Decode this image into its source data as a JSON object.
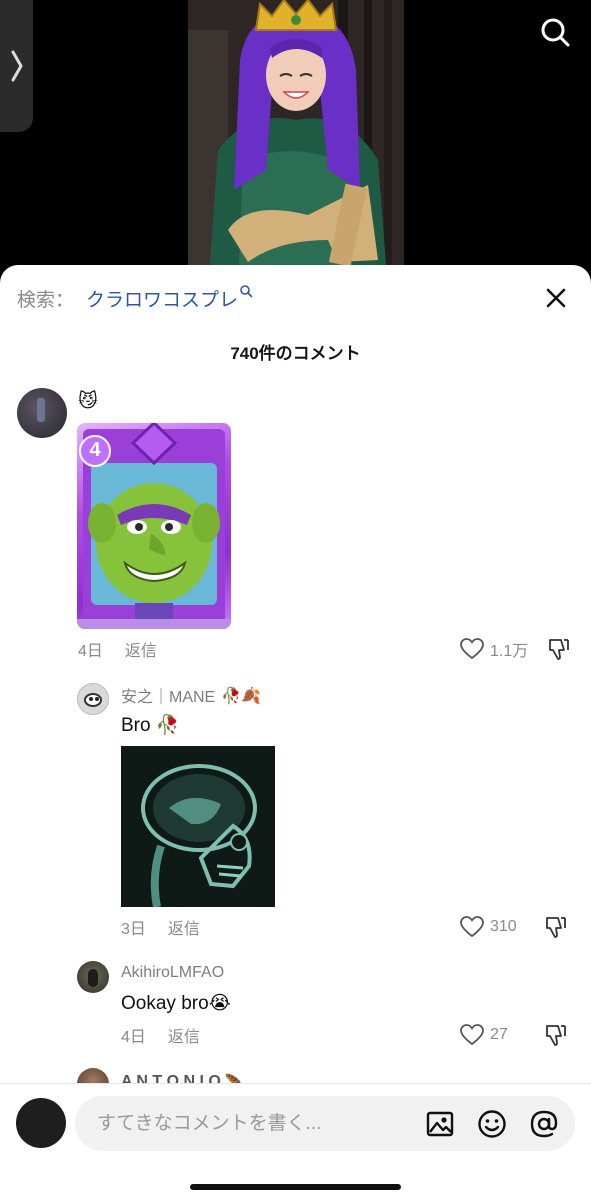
{
  "sheet": {
    "search_label": "検索：",
    "search_term": "クラロワコスプレ",
    "title": "740件のコメント"
  },
  "comments": [
    {
      "text": "😼",
      "image": "clash-royale-goblin-card",
      "card_cost": "4",
      "time": "4日",
      "reply_label": "返信",
      "likes": "1.1万"
    }
  ],
  "replies": [
    {
      "username": "安之｜MANE",
      "username_emoji": "🥀🍂",
      "text": "Bro 🥀",
      "image": "xray-skull",
      "image_caption": "@...",
      "time": "3日",
      "reply_label": "返信",
      "likes": "310"
    },
    {
      "username": "AkihiroLMFAO",
      "text": "Ookay bro😭",
      "time": "4日",
      "reply_label": "返信",
      "likes": "27"
    },
    {
      "username": "A N T O N I O",
      "username_emoji": "🪶"
    }
  ],
  "composer": {
    "placeholder": "すてきなコメントを書く..."
  },
  "icons": {
    "top_search": "search-icon",
    "side_tab": "chevron-right-icon",
    "close": "close-icon",
    "like": "heart-icon",
    "dislike": "thumbs-down-icon",
    "image": "image-icon",
    "emoji": "smiley-icon",
    "mention": "at-icon"
  }
}
